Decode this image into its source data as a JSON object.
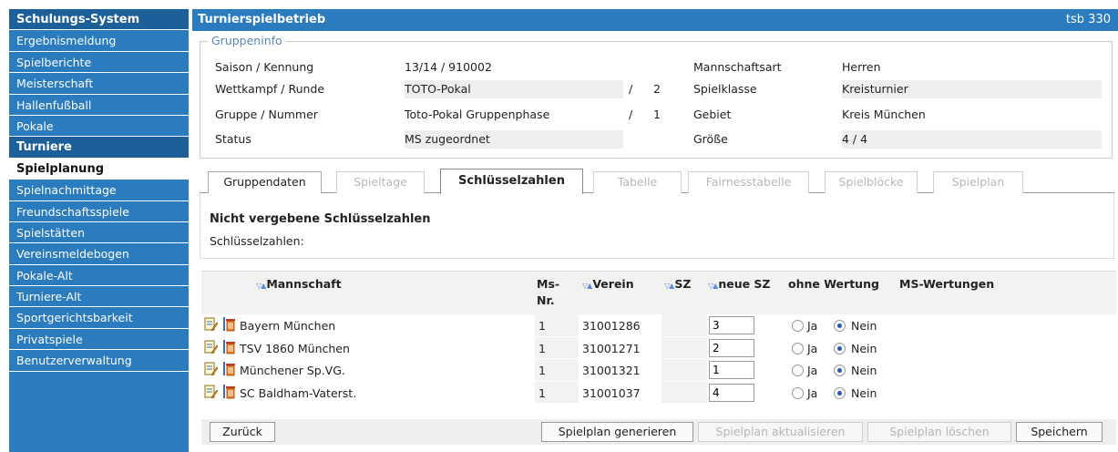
{
  "sidebar": {
    "items": [
      {
        "label": "Schulungs-System",
        "type": "header"
      },
      {
        "label": "Ergebnismeldung",
        "type": "item"
      },
      {
        "label": "Spielberichte",
        "type": "item"
      },
      {
        "label": "Meisterschaft",
        "type": "item"
      },
      {
        "label": "Hallenfußball",
        "type": "item"
      },
      {
        "label": "Pokale",
        "type": "item"
      },
      {
        "label": "Turniere",
        "type": "header"
      },
      {
        "label": "Spielplanung",
        "type": "active"
      },
      {
        "label": "Spielnachmittage",
        "type": "item"
      },
      {
        "label": "Freundschaftsspiele",
        "type": "item"
      },
      {
        "label": "Spielstätten",
        "type": "item"
      },
      {
        "label": "Vereinsmeldebogen",
        "type": "item"
      },
      {
        "label": "Pokale-Alt",
        "type": "item"
      },
      {
        "label": "Turniere-Alt",
        "type": "item"
      },
      {
        "label": "Sportgerichtsbarkeit",
        "type": "item"
      },
      {
        "label": "Privatspiele",
        "type": "item"
      },
      {
        "label": "Benutzerverwaltung",
        "type": "item"
      }
    ]
  },
  "header": {
    "title": "Turnierspielbetrieb",
    "code": "tsb 330"
  },
  "gruppeninfo": {
    "legend": "Gruppeninfo",
    "saison_label": "Saison / Kennung",
    "saison_value": "13/14   / 910002",
    "mannschaftsart_label": "Mannschaftsart",
    "mannschaftsart_value": "Herren",
    "wettkampf_label": "Wettkampf / Runde",
    "wettkampf_value": "TOTO-Pokal",
    "runde": "2",
    "spielklasse_label": "Spielklasse",
    "spielklasse_value": "Kreisturnier",
    "gruppe_label": "Gruppe / Nummer",
    "gruppe_value": "Toto-Pokal Gruppenphase",
    "nummer": "1",
    "gebiet_label": "Gebiet",
    "gebiet_value": "Kreis München",
    "status_label": "Status",
    "status_value": "MS zugeordnet",
    "groesse_label": "Größe",
    "groesse_value": "4   / 4",
    "slash": "/"
  },
  "tabs": [
    {
      "label": "Gruppendaten",
      "state": "normal"
    },
    {
      "label": "Spieltage",
      "state": "disabled"
    },
    {
      "label": "Schlüsselzahlen",
      "state": "active"
    },
    {
      "label": "Tabelle",
      "state": "disabled"
    },
    {
      "label": "Fairnesstabelle",
      "state": "disabled"
    },
    {
      "label": "Spielblöcke",
      "state": "disabled"
    },
    {
      "label": "Spielplan",
      "state": "disabled"
    }
  ],
  "panel": {
    "heading": "Nicht vergebene Schlüsselzahlen",
    "sub": "Schlüsselzahlen:"
  },
  "table": {
    "headers": {
      "mannschaft": "Mannschaft",
      "msnr_1": "Ms-",
      "msnr_2": "Nr.",
      "verein": "Verein",
      "sz": "SZ",
      "neue_sz": "neue SZ",
      "ohne_wertung": "ohne Wertung",
      "ms_wertungen": "MS-Wertungen"
    },
    "radio_yes": "Ja",
    "radio_no": "Nein",
    "rows": [
      {
        "mannschaft": "Bayern München",
        "msnr": "1",
        "verein": "31001286",
        "sz": "",
        "neue_sz": "3",
        "ohne_wertung": "Nein"
      },
      {
        "mannschaft": "TSV 1860 München",
        "msnr": "1",
        "verein": "31001271",
        "sz": "",
        "neue_sz": "2",
        "ohne_wertung": "Nein"
      },
      {
        "mannschaft": "Münchener Sp.VG.",
        "msnr": "1",
        "verein": "31001321",
        "sz": "",
        "neue_sz": "1",
        "ohne_wertung": "Nein"
      },
      {
        "mannschaft": "SC Baldham-Vaterst.",
        "msnr": "1",
        "verein": "31001037",
        "sz": "",
        "neue_sz": "4",
        "ohne_wertung": "Nein"
      }
    ]
  },
  "footer": {
    "zurueck": "Zurück",
    "generieren": "Spielplan generieren",
    "aktualisieren": "Spielplan aktualisieren",
    "loeschen": "Spielplan löschen",
    "speichern": "Speichern"
  },
  "colors": {
    "nav_blue": "#2b7bbf",
    "nav_dark": "#1d5f99",
    "sort_arrow": "#5b8dd6"
  },
  "icons": {
    "edit": "edit-icon",
    "delete": "trash-icon"
  }
}
